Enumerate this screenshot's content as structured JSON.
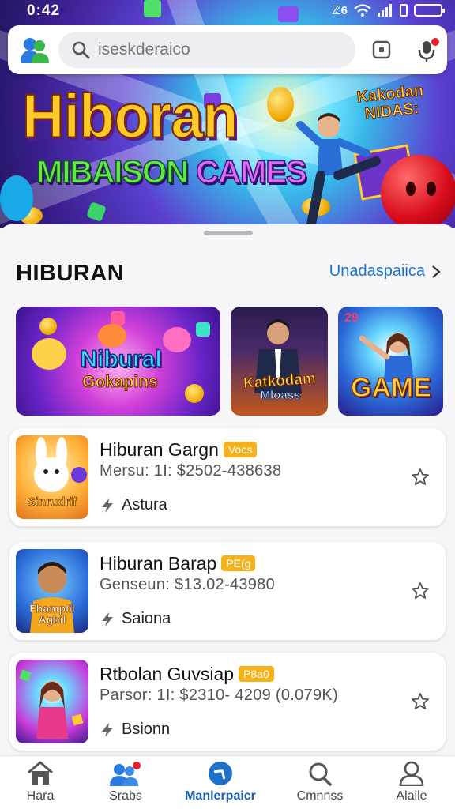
{
  "status": {
    "time": "0:42",
    "network": "ℤ6"
  },
  "search": {
    "placeholder": "iseskderaico"
  },
  "hero": {
    "title": "Hiboran",
    "subtitle_part1": "MIBAISON",
    "subtitle_part2": "CAMES",
    "tag": "Kakodan NIDAS:"
  },
  "section": {
    "title": "HIBURAN",
    "link": "Unadaspaiica"
  },
  "featured": [
    {
      "title_line1": "Nibural",
      "title_line2": "Gokapins"
    },
    {
      "title_line1": "Katkodam",
      "title_line2": "Mloass"
    },
    {
      "badge": "29",
      "title": "GAME"
    }
  ],
  "items": [
    {
      "title": "Hiburan Gargn",
      "badge": "Vocs",
      "subtitle": "Mersu:  1I:  $2502-438638",
      "meta": "Astura",
      "thumb_text": "Sinrudrif"
    },
    {
      "title": "Hiburan Barap",
      "badge": "PE(g",
      "subtitle": "Genseun:  $13.02-43980",
      "meta": "Saiona",
      "thumb_text": "Fhamplil Agbil"
    },
    {
      "title": "Rtbolan Guvsiap",
      "badge": "P8a0",
      "subtitle": "Parsor:  1I:  $2310- 4209 (0.079K)",
      "meta": "Bsionn",
      "thumb_text": ""
    }
  ],
  "nav": [
    {
      "label": "Hara",
      "icon": "home-icon"
    },
    {
      "label": "Srabs",
      "icon": "people-icon"
    },
    {
      "label": "Manlerpaicr",
      "icon": "compass-icon"
    },
    {
      "label": "Cmnnss",
      "icon": "search-icon"
    },
    {
      "label": "Alaile",
      "icon": "profile-icon"
    }
  ],
  "colors": {
    "accent": "#1a75c9",
    "badge": "#f6b21a",
    "nav_active": "#1a5ea8"
  }
}
